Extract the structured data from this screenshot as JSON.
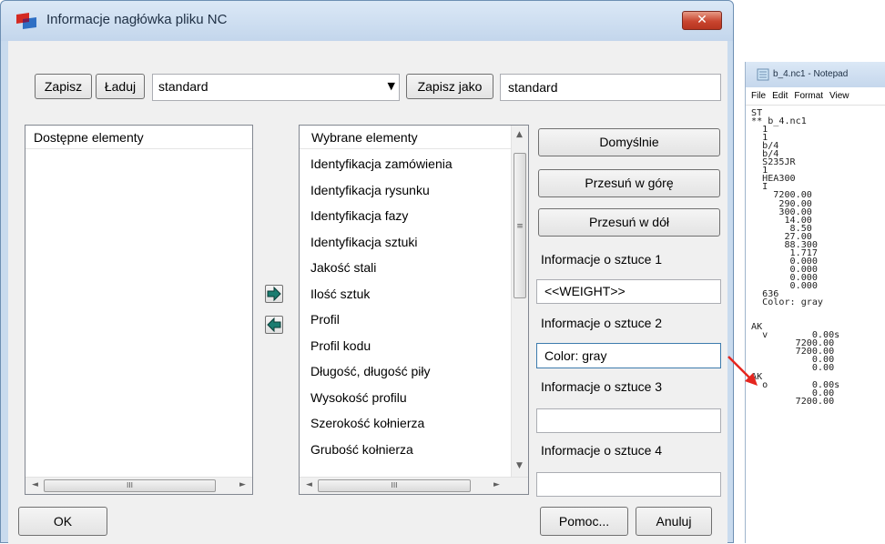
{
  "dialog": {
    "title": "Informacje nagłówka pliku NC",
    "close_glyph": "✕",
    "toolbar": {
      "save_label": "Zapisz",
      "load_label": "Ładuj",
      "preset_value": "standard",
      "save_as_label": "Zapisz jako",
      "save_as_value": "standard"
    },
    "available": {
      "header": "Dostępne elementy",
      "items": []
    },
    "selected": {
      "header": "Wybrane elementy",
      "items": [
        "Identyfikacja zamówienia",
        "Identyfikacja rysunku",
        "Identyfikacja fazy",
        "Identyfikacja sztuki",
        "Jakość stali",
        "Ilość sztuk",
        "Profil",
        "Profil kodu",
        "Długość, długość piły",
        "Wysokość profilu",
        "Szerokość kołnierza",
        "Grubość kołnierza"
      ]
    },
    "side": {
      "default_label": "Domyślnie",
      "move_up_label": "Przesuń w górę",
      "move_down_label": "Przesuń w dół",
      "info1_label": "Informacje o sztuce 1",
      "info1_value": "<<WEIGHT>>",
      "info2_label": "Informacje o sztuce 2",
      "info2_value": "Color: gray",
      "info3_label": "Informacje o sztuce 3",
      "info3_value": "",
      "info4_label": "Informacje o sztuce 4",
      "info4_value": ""
    },
    "footer": {
      "ok_label": "OK",
      "help_label": "Pomoc...",
      "cancel_label": "Anuluj"
    },
    "scroll": {
      "left_arrow": "◄",
      "right_arrow": "►",
      "up_arrow": "▲",
      "down_arrow": "▼",
      "grip": "III",
      "vgrip": "≡",
      "dropdown_arrow": "▼"
    }
  },
  "notepad": {
    "title": "b_4.nc1 - Notepad",
    "menu": [
      "File",
      "Edit",
      "Format",
      "View"
    ],
    "content": "ST\n** b_4.nc1\n  1\n  1\n  b/4\n  b/4\n  S235JR\n  1\n  HEA300\n  I\n    7200.00\n     290.00\n     300.00\n      14.00\n       8.50\n      27.00\n      88.300\n       1.717\n       0.000\n       0.000\n       0.000\n       0.000\n  636\n  Color: gray\n\n\nAK\n  v        0.00s\n        7200.00\n        7200.00\n           0.00\n           0.00\nAK\n  o        0.00s\n           0.00\n        7200.00"
  },
  "colors": {
    "accent_arrow": "#e5261f",
    "move_arrow": "#1a7c70"
  }
}
